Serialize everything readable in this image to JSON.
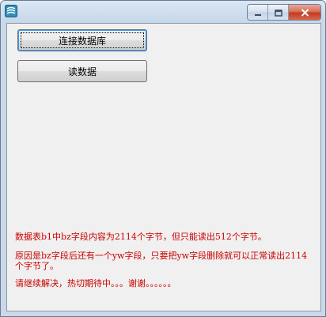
{
  "window": {
    "icon": "app-icon",
    "caption_buttons": [
      "minimize-icon",
      "maximize-icon",
      "close-icon"
    ],
    "accent_color": "#c9d9ea"
  },
  "buttons": {
    "connect_label": "连接数据库",
    "read_label": "读数据"
  },
  "messages": {
    "line1": "数据表b1中bz字段内容为2114个字节，但只能读出512个字节。",
    "line2": "原因是bz字段后还有一个yw字段，只要把yw字段删除就可以正常读出2114个字节了。",
    "line3": "请继续解决，热切期待中。。。谢谢。。。。。。",
    "color": "#cc0000"
  }
}
